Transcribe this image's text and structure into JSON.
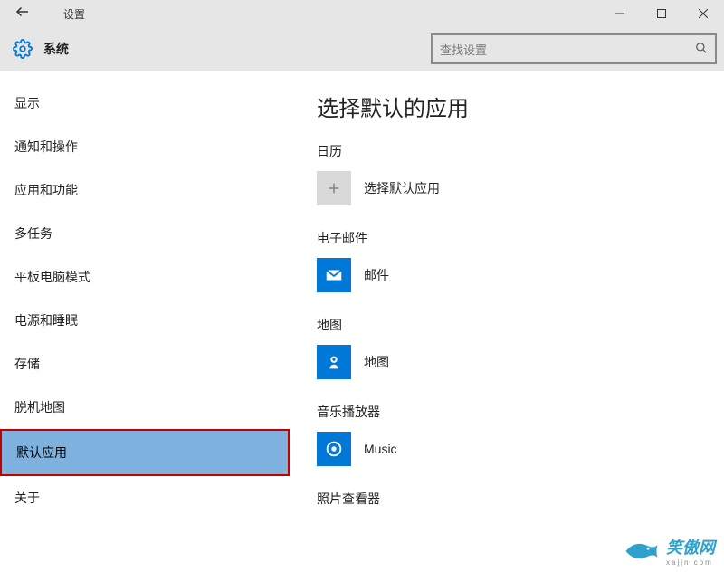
{
  "window": {
    "title": "设置"
  },
  "header": {
    "title": "系统",
    "search_placeholder": "查找设置"
  },
  "sidebar": {
    "items": [
      {
        "label": "显示"
      },
      {
        "label": "通知和操作"
      },
      {
        "label": "应用和功能"
      },
      {
        "label": "多任务"
      },
      {
        "label": "平板电脑模式"
      },
      {
        "label": "电源和睡眠"
      },
      {
        "label": "存储"
      },
      {
        "label": "脱机地图"
      },
      {
        "label": "默认应用"
      },
      {
        "label": "关于"
      }
    ],
    "selected_index": 8
  },
  "main": {
    "heading": "选择默认的应用",
    "categories": [
      {
        "label": "日历",
        "app": "选择默认应用",
        "icon": "plus"
      },
      {
        "label": "电子邮件",
        "app": "邮件",
        "icon": "mail"
      },
      {
        "label": "地图",
        "app": "地图",
        "icon": "maps"
      },
      {
        "label": "音乐播放器",
        "app": "Music",
        "icon": "music"
      },
      {
        "label": "照片查看器",
        "app": "",
        "icon": ""
      }
    ]
  },
  "watermark": {
    "text": "笑傲网",
    "sub": "xajjn.com"
  }
}
